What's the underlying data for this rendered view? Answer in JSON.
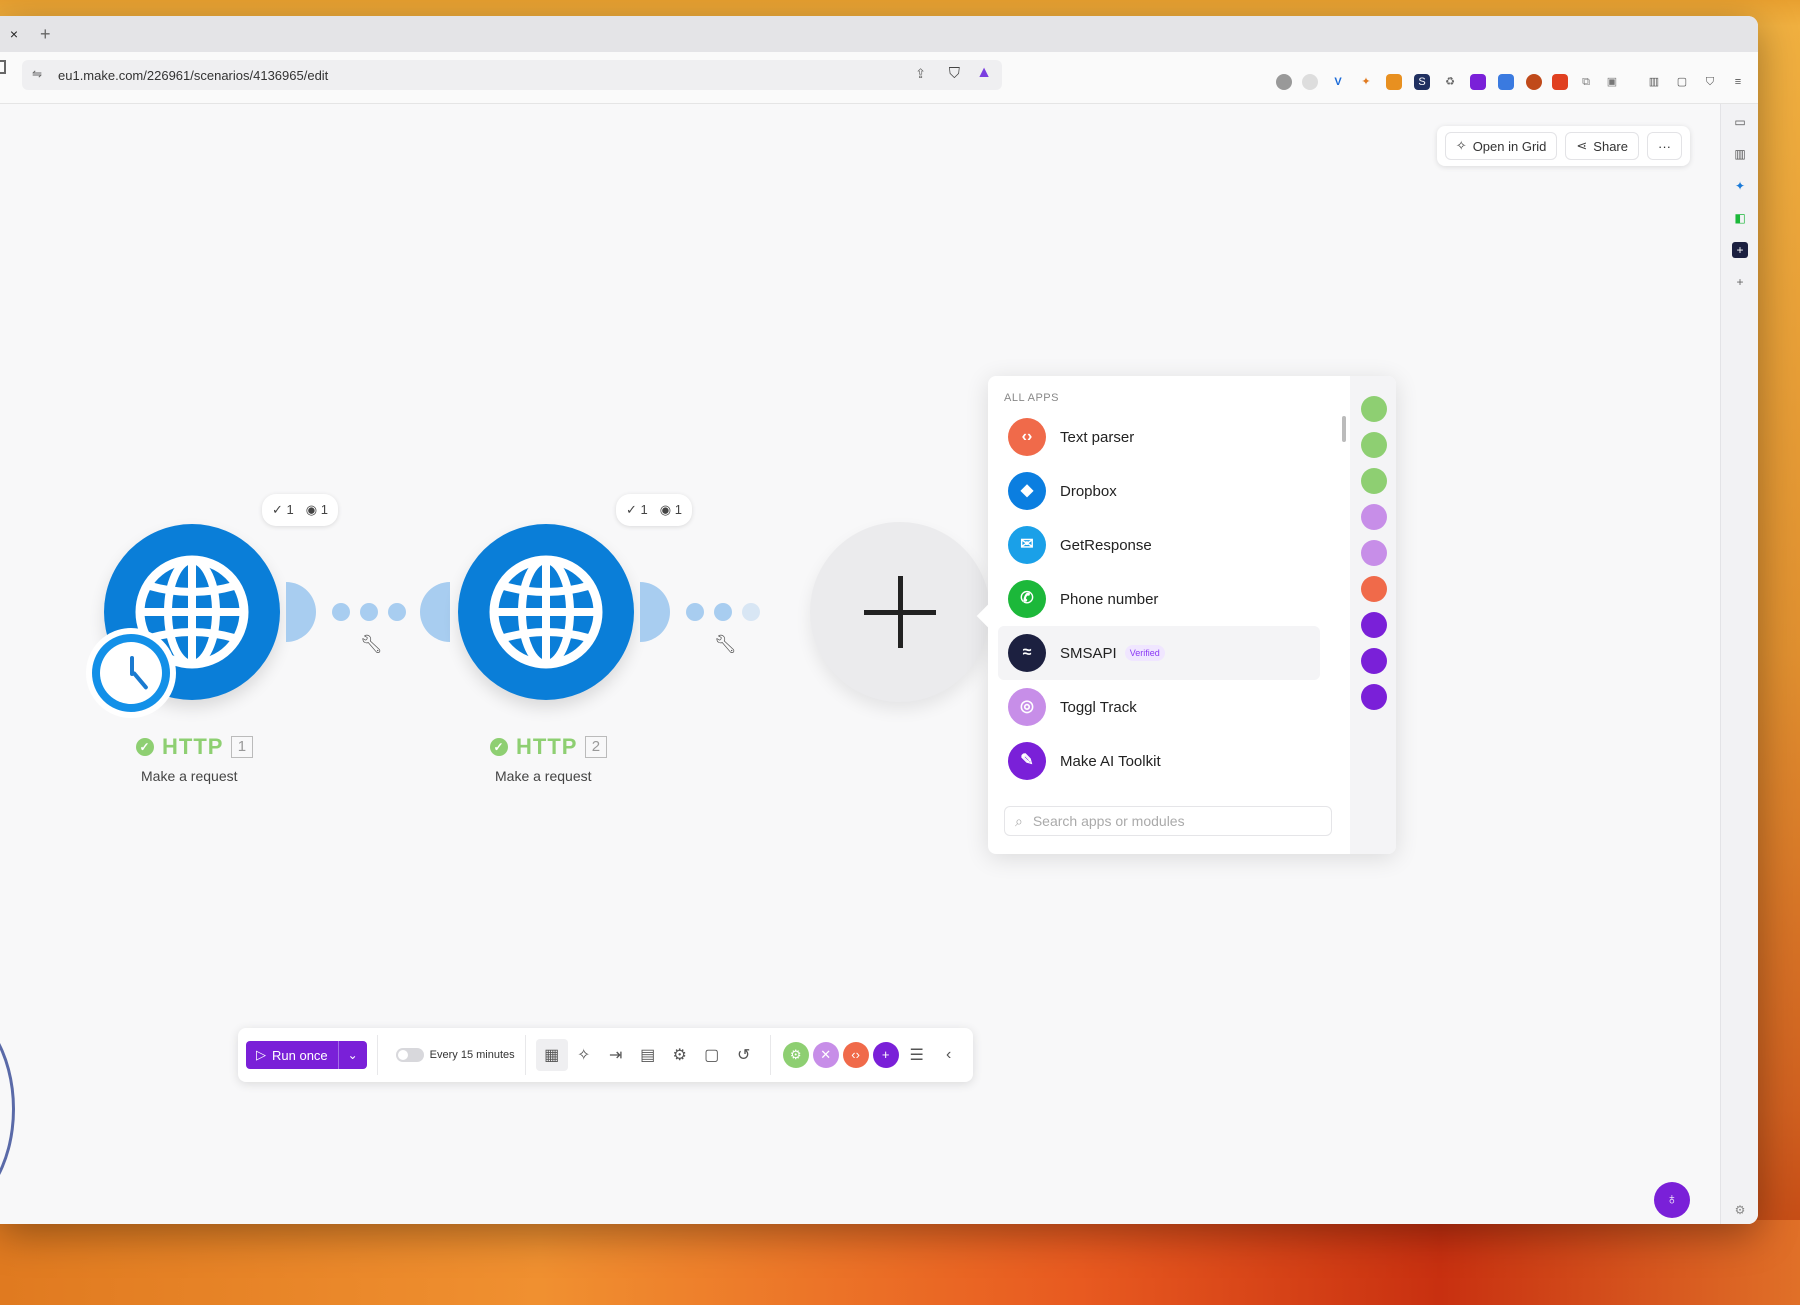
{
  "browser": {
    "tab_close": "×",
    "tab_new": "+",
    "url": "eu1.make.com/226961/scenarios/4136965/edit"
  },
  "header": {
    "open_in_grid": "Open in Grid",
    "share": "Share",
    "more": "···"
  },
  "modules": [
    {
      "title": "HTTP",
      "number": "1",
      "subtitle": "Make a request",
      "ops": "1",
      "views": "1"
    },
    {
      "title": "HTTP",
      "number": "2",
      "subtitle": "Make a request",
      "ops": "1",
      "views": "1"
    }
  ],
  "apps_panel": {
    "heading": "ALL APPS",
    "items": [
      {
        "label": "Text parser",
        "color": "#f06a4a",
        "icon": "text-parser-icon",
        "glyph": "‹›"
      },
      {
        "label": "Dropbox",
        "color": "#0b7ee0",
        "icon": "dropbox-icon",
        "glyph": "◆"
      },
      {
        "label": "GetResponse",
        "color": "#1aa0e8",
        "icon": "getresponse-icon",
        "glyph": "✉"
      },
      {
        "label": "Phone number",
        "color": "#1cb83a",
        "icon": "phone-icon",
        "glyph": "✆"
      },
      {
        "label": "SMSAPI",
        "color": "#1c2040",
        "icon": "smsapi-icon",
        "glyph": "≈",
        "badge": "Verified"
      },
      {
        "label": "Toggl Track",
        "color": "#c78ee8",
        "icon": "toggl-icon",
        "glyph": "◎"
      },
      {
        "label": "Make AI Toolkit",
        "color": "#7a20d8",
        "icon": "ai-toolkit-icon",
        "glyph": "✎"
      }
    ],
    "search_placeholder": "Search apps or modules",
    "side_colors": [
      "#8ecf72",
      "#8ecf72",
      "#8ecf72",
      "#c78ee8",
      "#c78ee8",
      "#f06a4a",
      "#7a20d8",
      "#7a20d8",
      "#7a20d8"
    ]
  },
  "bottom_bar": {
    "run_once": "Run once",
    "schedule": "Every 15 minutes"
  },
  "colors": {
    "accent": "#7a20d8",
    "module_blue": "#0a7ed8",
    "success_green": "#8ecf72"
  }
}
